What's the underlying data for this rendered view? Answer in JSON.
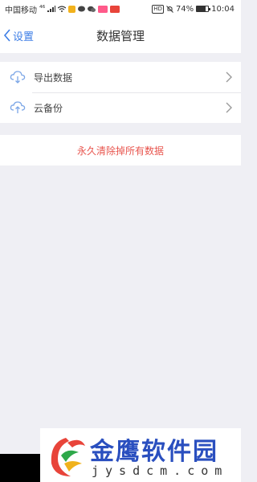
{
  "status_bar": {
    "carrier": "中国移动",
    "signal": "⁴⁶",
    "hd": "HD",
    "battery": "74%",
    "battery_level": 0.74,
    "time": "10:04"
  },
  "nav": {
    "back_label": "设置",
    "title": "数据管理"
  },
  "list": {
    "items": [
      {
        "label": "导出数据",
        "icon": "cloud-download-icon"
      },
      {
        "label": "云备份",
        "icon": "cloud-upload-icon"
      }
    ]
  },
  "danger": {
    "label": "永久清除掉所有数据"
  },
  "watermark": {
    "title": "金鹰软件园",
    "subtitle": "jysdcm.com"
  },
  "colors": {
    "accent": "#3d7ee6",
    "danger": "#e8554e",
    "background": "#efeff4"
  }
}
